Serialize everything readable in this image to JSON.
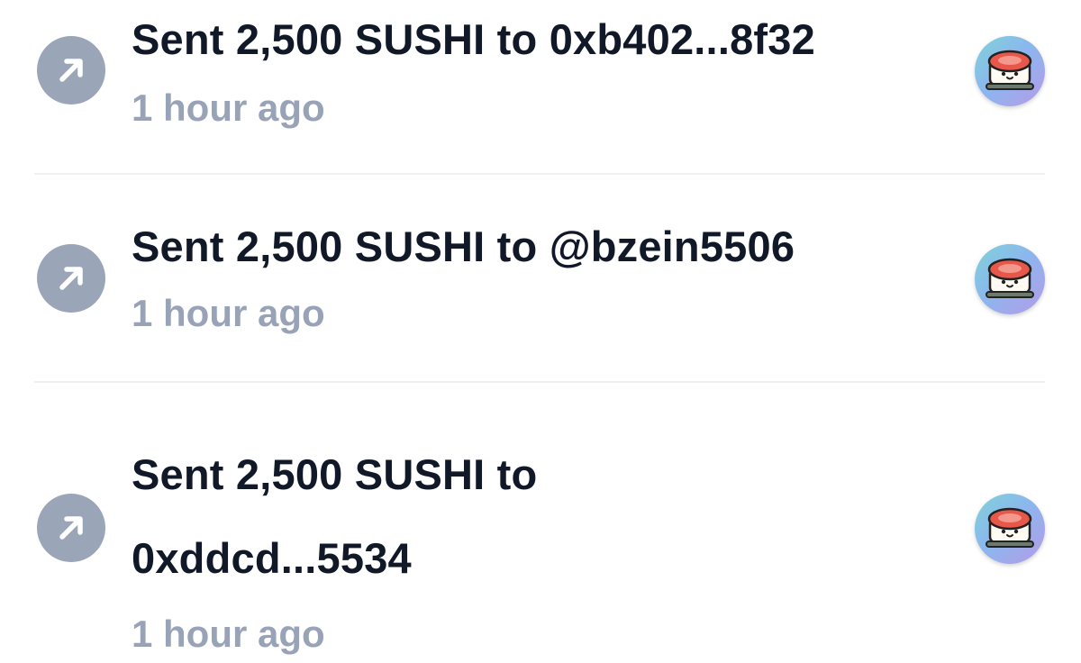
{
  "activity": {
    "items": [
      {
        "direction_icon": "arrow-up-right-icon",
        "title": "Sent 2,500 SUSHI to 0xb402...8f32",
        "time": "1 hour ago",
        "token_icon": "sushi-token-icon"
      },
      {
        "direction_icon": "arrow-up-right-icon",
        "title": "Sent 2,500 SUSHI to @bzein5506",
        "time": "1 hour ago",
        "token_icon": "sushi-token-icon"
      },
      {
        "direction_icon": "arrow-up-right-icon",
        "title": "Sent 2,500 SUSHI to 0xddcd...5534",
        "time": "1 hour ago",
        "token_icon": "sushi-token-icon"
      }
    ]
  },
  "colors": {
    "title": "#111827",
    "timestamp": "#98a3b8",
    "icon_background": "#9aa6b8",
    "divider": "#eef0f4"
  }
}
